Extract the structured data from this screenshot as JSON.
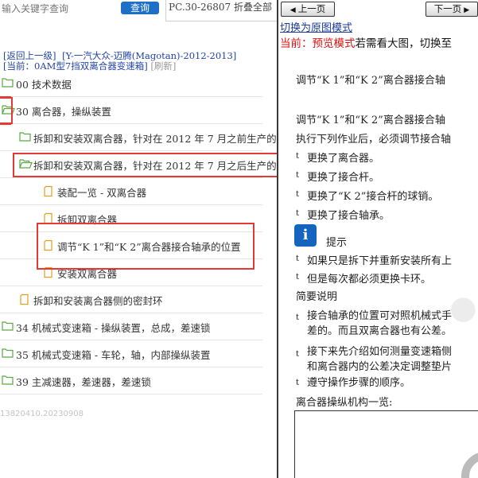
{
  "left": {
    "search": {
      "placeholder": "输入关键字查询",
      "button": "查询"
    },
    "pc_code": "PC.30-26807",
    "collapse_all": "折叠全部",
    "breadcrumb": {
      "back": "[返回上一级]",
      "path": "[Y-一汽大众-迈腾(Magotan)-2012-2013]"
    },
    "current": {
      "prefix": "[当前：",
      "name": "0AM型7挡双离合器变速箱",
      "suffix": "]",
      "refresh": "[刷新]"
    },
    "tree": [
      {
        "label": "00 技术数据",
        "type": "folder-closed"
      },
      {
        "label": "30 离合器，操纵装置",
        "type": "folder-open"
      },
      {
        "label": "拆卸和安装双离合器，针对在 2012 年 7 月之前生产的",
        "type": "folder-closed"
      },
      {
        "label": "拆卸和安装双离合器，针对在 2012 年 7 月之后生产的",
        "type": "folder-open"
      },
      {
        "label": "装配一览 - 双离合器",
        "type": "doc"
      },
      {
        "label": "拆卸双离合器",
        "type": "doc"
      },
      {
        "label": "调节“K 1”和“K 2”离合器接合轴承的位置",
        "type": "doc"
      },
      {
        "label": "安装双离合器",
        "type": "doc"
      },
      {
        "label": "拆卸和安装离合器侧的密封环",
        "type": "doc"
      },
      {
        "label": "34 机械式变速箱 - 操纵装置，总成，差速锁",
        "type": "folder-closed"
      },
      {
        "label": "35 机械式变速箱 - 车轮，轴，内部操纵装置",
        "type": "folder-closed"
      },
      {
        "label": "39 主减速器，差速器，差速锁",
        "type": "folder-closed"
      }
    ],
    "version": "13820410.20230908"
  },
  "right": {
    "prev": "上一页",
    "next": "下一页",
    "switch_link": "切换为原图模式",
    "mode": {
      "prefix": "当前：预览模式",
      "rest": "若需看大图，切换至"
    },
    "doc": {
      "title": "调节“K 1”和“K 2”离合器接合轴",
      "heading": "调节“K 1”和“K 2”离合器接合轴",
      "intro": "执行下列作业后，必须调节接合轴",
      "bullets": [
        "更换了离合器。",
        "更换了接合杆。",
        "更换了“K 2”接合杆的球销。",
        "更换了接合轴承。"
      ],
      "tip_label": "提示",
      "tip_bullets": [
        "如果只是拆下并重新安装所有上",
        "但是每次都必须更换卡环。"
      ],
      "summary_title": "简要说明",
      "summary_1a": "接合轴承的位置可对照机械式手",
      "summary_1b": "差的。而且双离合器也有公差。",
      "summary_2a": "接下来先介绍如何测量变速箱侧",
      "summary_2b": "和离合器内的公差决定调整垫片",
      "summary_3": "遵守操作步骤的顺序。",
      "overview": "离合器操纵机构一览:",
      "bullet_char": "t",
      "tip_char": "i"
    }
  },
  "colors": {
    "accent": "#1e6fc8",
    "highlight": "#e53935",
    "link": "#2244aa",
    "mode_red": "#e01010"
  }
}
